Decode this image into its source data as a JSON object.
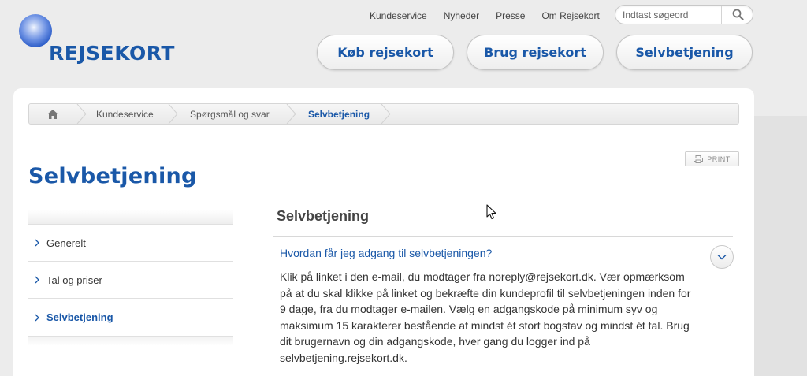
{
  "header": {
    "logo_text": "REJSEKORT",
    "top_links": [
      "Kundeservice",
      "Nyheder",
      "Presse",
      "Om Rejsekort"
    ],
    "search_placeholder": "Indtast søgeord",
    "main_nav": [
      "Køb rejsekort",
      "Brug rejsekort",
      "Selvbetjening"
    ]
  },
  "breadcrumb": [
    "Kundeservice",
    "Spørgsmål og svar",
    "Selvbetjening"
  ],
  "print_label": "PRINT",
  "page_title": "Selvbetjening",
  "sidebar": {
    "items": [
      {
        "label": "Generelt",
        "active": false
      },
      {
        "label": "Tal og priser",
        "active": false
      },
      {
        "label": "Selvbetjening",
        "active": true
      }
    ]
  },
  "main": {
    "section_title": "Selvbetjening",
    "faq": {
      "question": "Hvordan får jeg adgang til selvbetjeningen?",
      "answer_lines": [
        "Klik på linket i den e-mail, du modtager fra noreply@rejsekort.dk. Vær opmærksom",
        "på at du skal klikke på linket og bekræfte din kundeprofil til selvbetjeningen inden for",
        "9 dage, fra du modtager e-mailen. Vælg en adgangskode på minimum syv og",
        "maksimum 15 karakterer bestående af mindst ét stort bogstav og mindst ét tal. Brug",
        "dit brugernavn og din adgangskode, hver gang du logger ind på",
        "selvbetjening.rejsekort.dk."
      ]
    }
  },
  "colors": {
    "brand_blue": "#1a58a8",
    "background": "#ececec"
  }
}
